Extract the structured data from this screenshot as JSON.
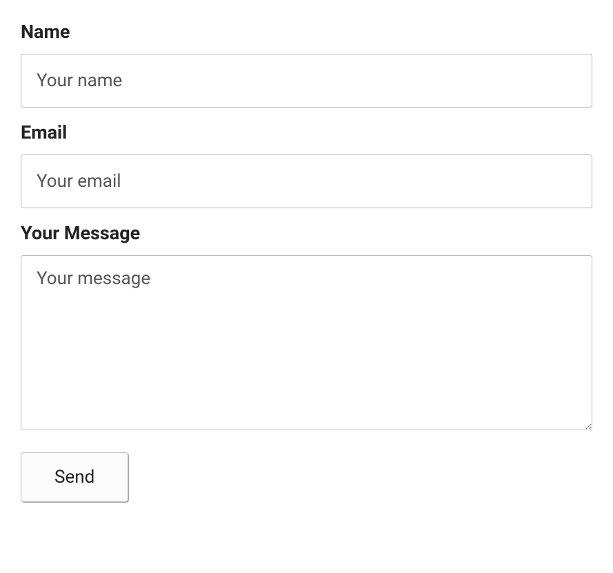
{
  "form": {
    "name": {
      "label": "Name",
      "placeholder": "Your name",
      "value": ""
    },
    "email": {
      "label": "Email",
      "placeholder": "Your email",
      "value": ""
    },
    "message": {
      "label": "Your Message",
      "placeholder": "Your message",
      "value": ""
    },
    "submit": {
      "label": "Send"
    }
  }
}
